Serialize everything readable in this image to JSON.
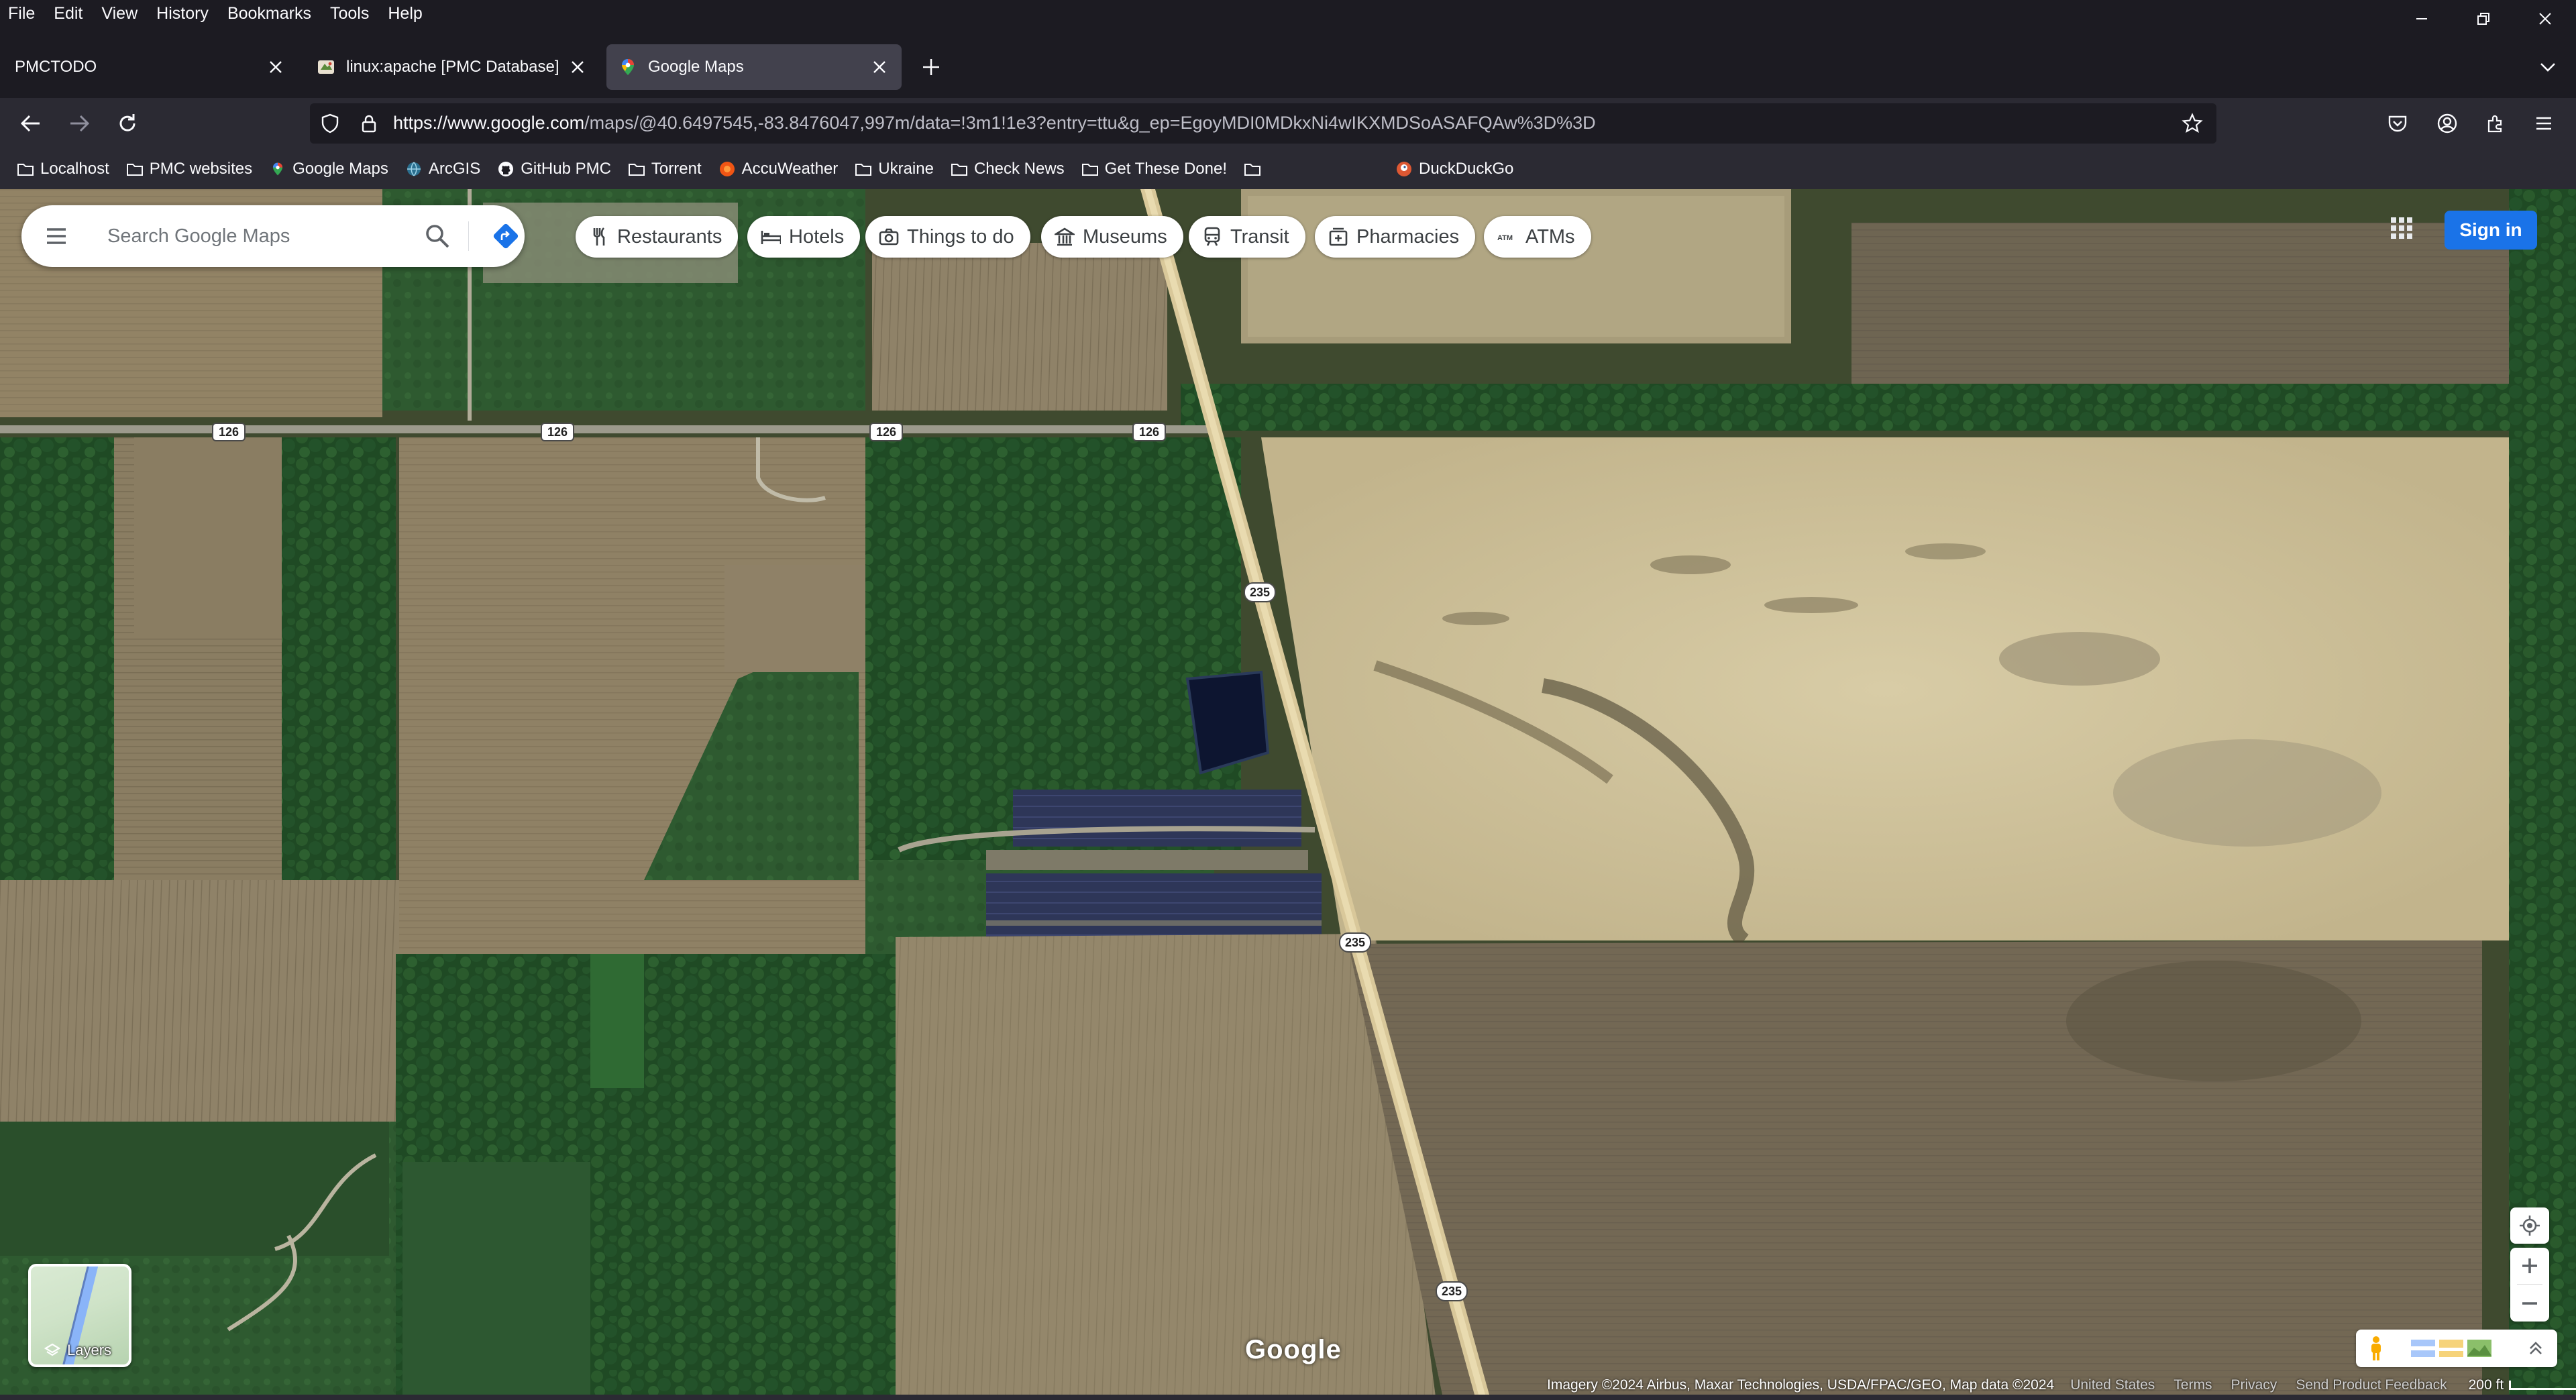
{
  "menubar": {
    "items": [
      "File",
      "Edit",
      "View",
      "History",
      "Bookmarks",
      "Tools",
      "Help"
    ]
  },
  "tabs": [
    {
      "title": "PMCTODO",
      "active": false,
      "icon": "none"
    },
    {
      "title": "linux:apache [PMC Database]",
      "active": false,
      "icon": "wiki-favicon-icon"
    },
    {
      "title": "Google Maps",
      "active": true,
      "icon": "google-maps-pin-icon"
    }
  ],
  "navbar": {
    "url_host": "https://www.google.com",
    "url_path": "/maps/@40.6497545,-83.8476047,997m/data=!3m1!1e3?entry=ttu&g_ep=EgoyMDI0MDkxNi4wIKXMDSoASAFQAw%3D%3D"
  },
  "bookmarks": [
    {
      "label": "Localhost",
      "icon": "folder-icon"
    },
    {
      "label": "PMC websites",
      "icon": "folder-icon"
    },
    {
      "label": "Google Maps",
      "icon": "google-maps-pin-icon"
    },
    {
      "label": "ArcGIS",
      "icon": "globe-icon"
    },
    {
      "label": "GitHub PMC",
      "icon": "github-icon"
    },
    {
      "label": "Torrent",
      "icon": "folder-icon"
    },
    {
      "label": "AccuWeather",
      "icon": "sun-icon"
    },
    {
      "label": "Ukraine",
      "icon": "folder-icon"
    },
    {
      "label": "Check News",
      "icon": "folder-icon"
    },
    {
      "label": "Get These Done!",
      "icon": "folder-icon"
    },
    {
      "label": "",
      "icon": "folder-icon"
    },
    {
      "label": "DuckDuckGo",
      "icon": "duckduckgo-icon"
    }
  ],
  "map": {
    "search_placeholder": "Search Google Maps",
    "chips": [
      {
        "label": "Restaurants",
        "icon": "fork-knife-icon"
      },
      {
        "label": "Hotels",
        "icon": "bed-icon"
      },
      {
        "label": "Things to do",
        "icon": "camera-icon"
      },
      {
        "label": "Museums",
        "icon": "museum-icon"
      },
      {
        "label": "Transit",
        "icon": "train-icon"
      },
      {
        "label": "Pharmacies",
        "icon": "pharmacy-icon"
      },
      {
        "label": "ATMs",
        "icon": "atm-icon"
      }
    ],
    "signin_label": "Sign in",
    "layers_label": "Layers",
    "google_logo": "Google",
    "road_labels": [
      "126",
      "126",
      "126",
      "126",
      "235",
      "235",
      "235"
    ],
    "attribution": "Imagery ©2024 Airbus, Maxar Technologies, USDA/FPAC/GEO, Map data ©2024",
    "footer_links": [
      "United States",
      "Terms",
      "Privacy",
      "Send Product Feedback"
    ],
    "scale_label": "200 ft"
  },
  "colors": {
    "chrome_dark": "#1c1b22",
    "chrome_mid": "#2b2a33",
    "active_tab": "#42414d",
    "signin_blue": "#1a73e8",
    "directions_blue": "#1a73e8"
  }
}
